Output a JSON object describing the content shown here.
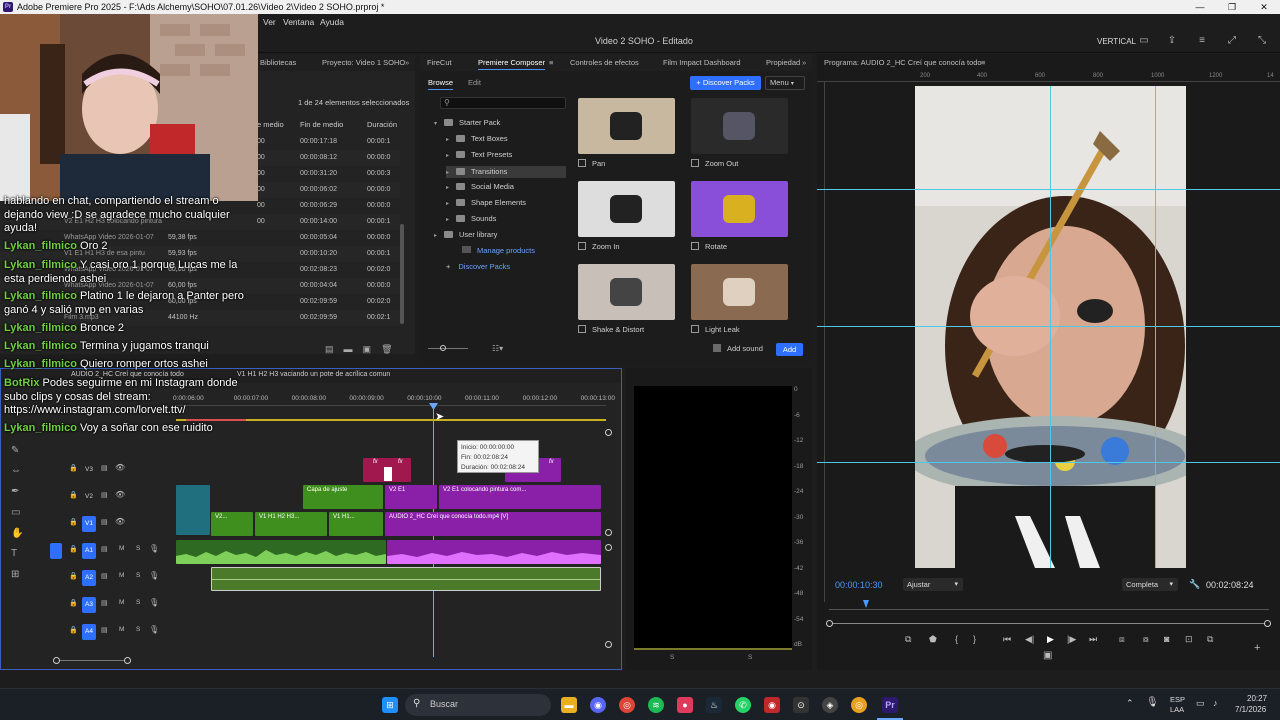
{
  "window": {
    "title": "Adobe Premiere Pro 2025 - F:\\Ads Alchemy\\SOHO\\07.01.26\\Video 2\\Video 2 SOHO.prproj *",
    "app_icon": "Pr",
    "minimize": "—",
    "maximize": "❐",
    "close": "✕"
  },
  "menu": {
    "items": [
      "Ver",
      "Ventana",
      "Ayuda"
    ]
  },
  "header": {
    "title": "Video 2 SOHO - Editado",
    "layout_label": "VERTICAL"
  },
  "project_panel": {
    "tabs": [
      "Bibliotecas",
      "Proyecto: Video 1 SOHO"
    ],
    "selection_status": "1 de 24 elementos seleccionados",
    "columns": [
      "e medio",
      "Fin de medio",
      "Duración"
    ],
    "rows": [
      {
        "name": "",
        "start": "00",
        "end": "00:00:17:18",
        "dur": "00:00:1"
      },
      {
        "name": "",
        "start": "00",
        "end": "00:00:08:12",
        "dur": "00:00:0"
      },
      {
        "name": "",
        "start": "00",
        "end": "00:00:31:20",
        "dur": "00:00:3"
      },
      {
        "name": "",
        "start": "00",
        "end": "00:00:06:02",
        "dur": "00:00:0"
      },
      {
        "name": "",
        "start": "00",
        "end": "00:00:06:29",
        "dur": "00:00:0"
      },
      {
        "name": "V2 E1 H2 H3 colocando pintura",
        "start": "00",
        "end": "00:00:14:00",
        "dur": "00:00:1"
      },
      {
        "name": "WhatsApp Video 2026-01-07",
        "start": "59,38 fps",
        "end": "00:00:05:04",
        "dur": "00:00:0"
      },
      {
        "name": "V1 E1 H1 H3 de esa pintu",
        "start": "59,93 fps",
        "end": "00:00:10:20",
        "dur": "00:00:1"
      },
      {
        "name": "WhatsApp Video 2026-01-07",
        "start": "60,00 fps",
        "end": "00:02:08:23",
        "dur": "00:02:0"
      },
      {
        "name": "WhatsApp Video 2026-01-07",
        "start": "60,00 fps",
        "end": "00:00:04:04",
        "dur": "00:00:0"
      },
      {
        "name": "",
        "start": "60,00 fps",
        "end": "00:02:09:59",
        "dur": "00:02:0"
      },
      {
        "name": "Film 3.mp3",
        "start": "44100 Hz",
        "end": "00:02:09:59",
        "dur": "00:02:1"
      }
    ]
  },
  "composer_panel": {
    "tabs": [
      "FireCut",
      "Premiere Composer",
      "Controles de efectos",
      "Film Impact Dashboard",
      "Propiedad"
    ],
    "sub_tabs": [
      "Browse",
      "Edit"
    ],
    "discover_button": "Discover Packs",
    "menu_button": "Menu",
    "tree": [
      {
        "label": "Starter Pack",
        "level": 0
      },
      {
        "label": "Text Boxes",
        "level": 1
      },
      {
        "label": "Text Presets",
        "level": 1
      },
      {
        "label": "Transitions",
        "level": 1,
        "selected": true
      },
      {
        "label": "Social Media",
        "level": 1
      },
      {
        "label": "Shape Elements",
        "level": 1
      },
      {
        "label": "Sounds",
        "level": 1
      },
      {
        "label": "User library",
        "level": 0
      }
    ],
    "manage_products": "Manage products",
    "discover_packs_link": "Discover Packs",
    "thumbnails": [
      "Pan",
      "Zoom Out",
      "Zoom In",
      "Rotate",
      "Shake & Distort",
      "Light Leak"
    ],
    "add_sound_label": "Add sound",
    "add_button": "Add"
  },
  "program_monitor": {
    "tab": "Programa: AUDIO 2_HC Creí que conocía todo",
    "timecode": "00:00:10:30",
    "fit": "Ajustar",
    "quality": "Completa",
    "duration": "00:02:08:24"
  },
  "timeline": {
    "sequence_tab": "AUDIO 2_HC Creí que conocía todo",
    "other_tab": "V1 H1 H2 H3 vaciando un pote de acrílica comun",
    "ruler": [
      "0:00:06:00",
      "00:00:07:00",
      "00:00:08:00",
      "00:00:09:00",
      "00:00:10:00",
      "00:00:11:00",
      "00:00:12:00",
      "00:00:13:00"
    ],
    "tracks": [
      "V3",
      "V2",
      "V1",
      "A1",
      "A2",
      "A3",
      "A4"
    ],
    "clips": {
      "adjustment": "Capa de ajuste",
      "v2a": "V2 E1",
      "v2b": "V2 E1 colocando pintura com...",
      "v1a": "V2...",
      "v1b": "V1 H1 H2 H3...",
      "v1c": "V1 H1...",
      "v1main": "AUDIO 2_HC Creí que conocía todo.mp4 [V]",
      "fx": "fx"
    },
    "tooltip": {
      "start": "Inicio: 00:00:00:00",
      "end": "Fin: 00:02:08:24",
      "duration": "Duración: 00:02:08:24"
    },
    "track_buttons": {
      "mute": "M",
      "solo": "S"
    }
  },
  "audio_meter": {
    "scale": [
      "0",
      "-6",
      "-12",
      "-18",
      "-24",
      "-30",
      "-36",
      "-42",
      "-48",
      "-54",
      "dB"
    ],
    "channels": [
      "S",
      "S"
    ]
  },
  "chat": [
    {
      "user": "",
      "text": "hablando en chat, compartiendo el stream o"
    },
    {
      "user": "",
      "text": "dejando view :D se agradece mucho cualquier"
    },
    {
      "user": "",
      "text": "ayuda!"
    },
    {
      "user": "Lykan_filmico",
      "text": "Oro 2"
    },
    {
      "user": "Lykan_filmico",
      "text": "Y casi oro 1 porque Lucas me la"
    },
    {
      "user": "",
      "text": "esta perdiendo ashei"
    },
    {
      "user": "Lykan_filmico",
      "text": "Platino 1 le dejaron a Panter pero"
    },
    {
      "user": "",
      "text": "ganó 4 y salió mvp en varias"
    },
    {
      "user": "Lykan_filmico",
      "text": "Bronce 2"
    },
    {
      "user": "Lykan_filmico",
      "text": "Termina y jugamos tranqui"
    },
    {
      "user": "Lykan_filmico",
      "text": "Quiero romper ortos ashei"
    },
    {
      "user": "BotRix",
      "text": "Podes seguirme en mi Instagram donde"
    },
    {
      "user": "",
      "text": "subo clips y cosas del stream:"
    },
    {
      "user": "",
      "text": "https://www.instagram.com/lorvelt.ttv/"
    },
    {
      "user": "Lykan_filmico",
      "text": "Voy a soñar con ese ruidito"
    }
  ],
  "taskbar": {
    "search_placeholder": "Buscar",
    "lang": "ESP",
    "lang2": "LAA",
    "time": "20:27",
    "date": "7/1/2026"
  },
  "colors": {
    "accent_blue": "#2f6fff",
    "clip_green": "#3f8f1f",
    "clip_purple": "#8a1fa8",
    "clip_teal": "#1f6f7f",
    "clip_magenta": "#a1184f",
    "chat_user": "#6fcf3f"
  }
}
